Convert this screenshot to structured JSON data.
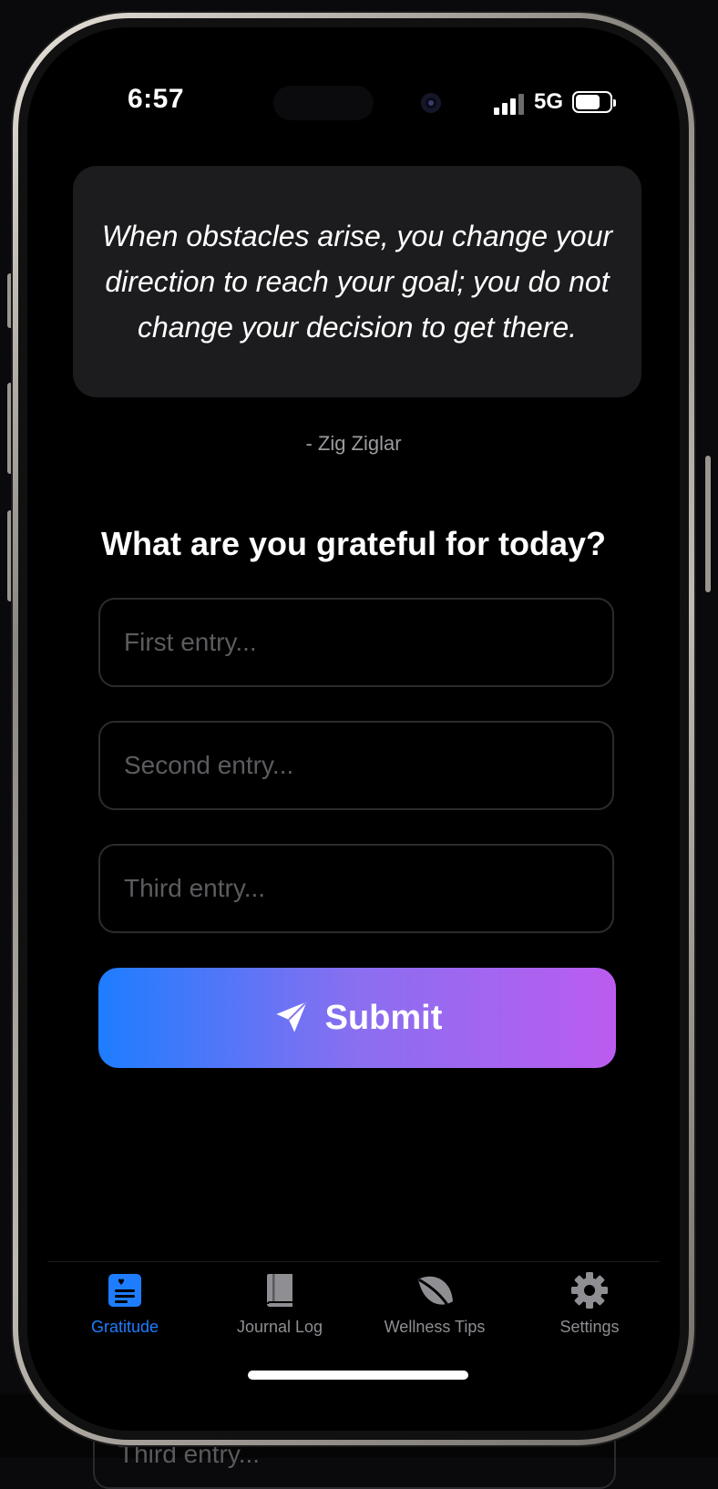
{
  "status_bar": {
    "time": "6:57",
    "network": "5G",
    "battery_level": 0.8
  },
  "quote": {
    "text": "When obstacles arise, you change your direction to reach your goal; you do not change your decision to get there.",
    "author": "- Zig Ziglar"
  },
  "prompt": "What are you grateful for today?",
  "entries": {
    "first_placeholder": "First entry...",
    "second_placeholder": "Second entry...",
    "third_placeholder": "Third entry...",
    "first_value": "",
    "second_value": "",
    "third_value": ""
  },
  "submit": {
    "label": "Submit",
    "icon": "paper-plane-icon"
  },
  "tabs": [
    {
      "label": "Gratitude",
      "icon": "journal-heart-icon",
      "active": true
    },
    {
      "label": "Journal Log",
      "icon": "book-icon",
      "active": false
    },
    {
      "label": "Wellness Tips",
      "icon": "leaf-icon",
      "active": false
    },
    {
      "label": "Settings",
      "icon": "gear-icon",
      "active": false
    }
  ],
  "background_peek": {
    "text": "Third entry..."
  },
  "colors": {
    "accent": "#1e7dff",
    "gradient_start": "#1e7dff",
    "gradient_end": "#bb5cef",
    "inactive_tab": "#8e8e93",
    "card": "#1c1c1e"
  }
}
